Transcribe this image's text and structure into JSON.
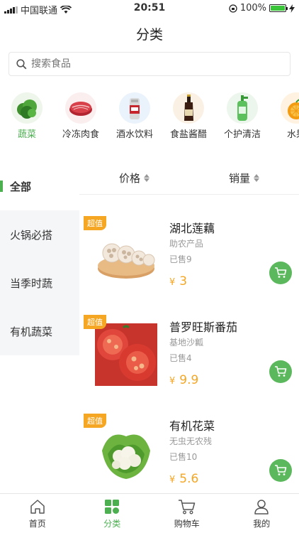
{
  "status_bar": {
    "carrier": "中国联通",
    "time": "20:51",
    "battery": "100%",
    "battery_level": 1.0
  },
  "nav": {
    "title": "分类"
  },
  "search": {
    "placeholder": "搜索食品"
  },
  "categories": [
    {
      "label": "蔬菜",
      "icon": "vegetable",
      "active": true
    },
    {
      "label": "冷冻肉食",
      "icon": "meat"
    },
    {
      "label": "酒水饮料",
      "icon": "drink"
    },
    {
      "label": "食盐酱醋",
      "icon": "sauce"
    },
    {
      "label": "个护清洁",
      "icon": "cleaning"
    },
    {
      "label": "水果",
      "icon": "fruit"
    }
  ],
  "left_menu": [
    {
      "label": "全部",
      "active": true
    },
    {
      "label": "火锅必搭"
    },
    {
      "label": "当季时蔬"
    },
    {
      "label": "有机蔬菜"
    }
  ],
  "sort_bar": {
    "price_label": "价格",
    "sales_label": "销量"
  },
  "products": [
    {
      "tag": "超值",
      "name": "湖北莲藕",
      "desc": "助农产品",
      "sold": "已售9",
      "currency": "¥",
      "price": "3"
    },
    {
      "tag": "超值",
      "name": "普罗旺斯番茄",
      "desc": "基地沙瓤",
      "sold": "已售4",
      "currency": "¥",
      "price": "9.9"
    },
    {
      "tag": "超值",
      "name": "有机花菜",
      "desc": "无虫无农残",
      "sold": "已售10",
      "currency": "¥",
      "price": "5.6"
    }
  ],
  "tabbar": [
    {
      "label": "首页",
      "icon": "home-icon"
    },
    {
      "label": "分类",
      "icon": "category-icon",
      "active": true
    },
    {
      "label": "购物车",
      "icon": "cart-icon"
    },
    {
      "label": "我的",
      "icon": "profile-icon"
    }
  ],
  "colors": {
    "accent": "#4caf50",
    "price": "#f5a623",
    "cart_button": "#5cb85c"
  }
}
